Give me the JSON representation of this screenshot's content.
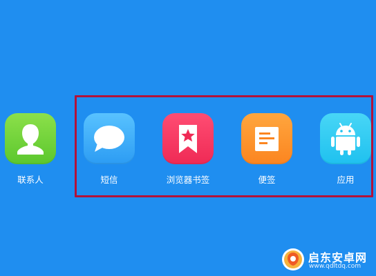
{
  "apps": [
    {
      "label": "联系人",
      "icon": "contacts-icon",
      "color": "#6fd23a"
    },
    {
      "label": "短信",
      "icon": "message-bubble-icon",
      "color": "#3fb0f8"
    },
    {
      "label": "浏览器书签",
      "icon": "bookmark-star-icon",
      "color": "#f5365f"
    },
    {
      "label": "便签",
      "icon": "note-icon",
      "color": "#fd922c"
    },
    {
      "label": "应用",
      "icon": "android-icon",
      "color": "#30cbf2"
    }
  ],
  "selection": {
    "border_color": "#b2123a"
  },
  "background_color": "#1f8ef0",
  "watermark": {
    "name": "启东安卓网",
    "url": "www.qdltdq.com",
    "logo_icon": "orange-circle-logo-icon"
  }
}
